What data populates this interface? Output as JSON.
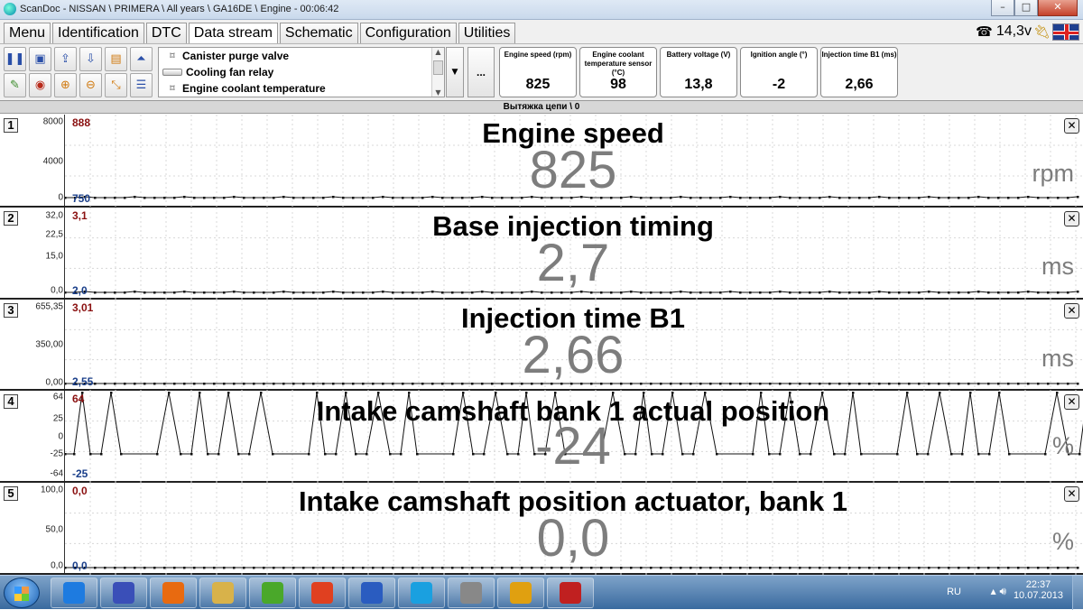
{
  "window": {
    "title": "ScanDoc - NISSAN \\ PRIMERA \\ All years \\ GA16DE \\ Engine - 00:06:42"
  },
  "tabs": [
    {
      "label": "Menu"
    },
    {
      "label": "Identification"
    },
    {
      "label": "DTC"
    },
    {
      "label": "Data stream",
      "active": true
    },
    {
      "label": "Schematic"
    },
    {
      "label": "Configuration"
    },
    {
      "label": "Utilities"
    }
  ],
  "status": {
    "voltage": "14,3v",
    "language": "English (UK flag)"
  },
  "toolbar": {
    "icons": [
      "pause-icon",
      "save-icon",
      "export-icon",
      "import-icon",
      "open-icon",
      "chart-icon",
      "leaf-icon",
      "record-icon",
      "zoom-in-icon",
      "zoom-out-icon",
      "fit-icon",
      "list-icon"
    ],
    "more_label": "..."
  },
  "param_list": [
    {
      "label": "Canister purge valve",
      "icon": "pin"
    },
    {
      "label": "Cooling fan relay",
      "icon": "bar"
    },
    {
      "label": "Engine coolant temperature",
      "icon": "pin"
    }
  ],
  "mini_gauges": [
    {
      "label": "Engine speed  (rpm)",
      "value": "825"
    },
    {
      "label": "Engine coolant temperature sensor (°C)",
      "value": "98"
    },
    {
      "label": "Battery voltage  (V)",
      "value": "13,8"
    },
    {
      "label": "Ignition angle  (°)",
      "value": "-2"
    },
    {
      "label": "Injection time B1 (ms)",
      "value": "2,66"
    }
  ],
  "group_bar": "Вытяжка цепи \\ 0",
  "panels": [
    {
      "num": "1",
      "title": "Engine speed",
      "value": "825",
      "unit": "rpm",
      "max_label": "888",
      "min_label": "750",
      "ticks": [
        "8000",
        "4000",
        "0"
      ],
      "colors": {
        "max": "#8a1010",
        "min": "#1a3f8a"
      }
    },
    {
      "num": "2",
      "title": "Base injection timing",
      "value": "2,7",
      "unit": "ms",
      "max_label": "3,1",
      "min_label": "2,0",
      "ticks": [
        "32,0",
        "22,5",
        "15,0",
        "0,0"
      ]
    },
    {
      "num": "3",
      "title": "Injection time B1",
      "value": "2,66",
      "unit": "ms",
      "max_label": "3,01",
      "min_label": "2,55",
      "ticks": [
        "655,35",
        "350,00",
        "0,00"
      ]
    },
    {
      "num": "4",
      "title": "Intake camshaft bank 1 actual position",
      "value": "-24",
      "unit": "%",
      "max_label": "64",
      "min_label": "-25",
      "ticks": [
        "64",
        "25",
        "0",
        "-25",
        "-64"
      ]
    },
    {
      "num": "5",
      "title": "Intake camshaft position actuator, bank 1",
      "value": "0,0",
      "unit": "%",
      "max_label": "0,0",
      "min_label": "0,0",
      "ticks": [
        "100,0",
        "50,0",
        "0,0"
      ]
    }
  ],
  "taskbar": {
    "lang": "RU",
    "time": "22:37",
    "date": "10.07.2013",
    "apps": [
      "ie-icon",
      "itunes-icon",
      "media-icon",
      "explorer-icon",
      "icq-icon",
      "chrome-icon",
      "word-icon",
      "skype-icon",
      "scandoc-icon",
      "chevrolet-icon",
      "cl-icon"
    ]
  }
}
